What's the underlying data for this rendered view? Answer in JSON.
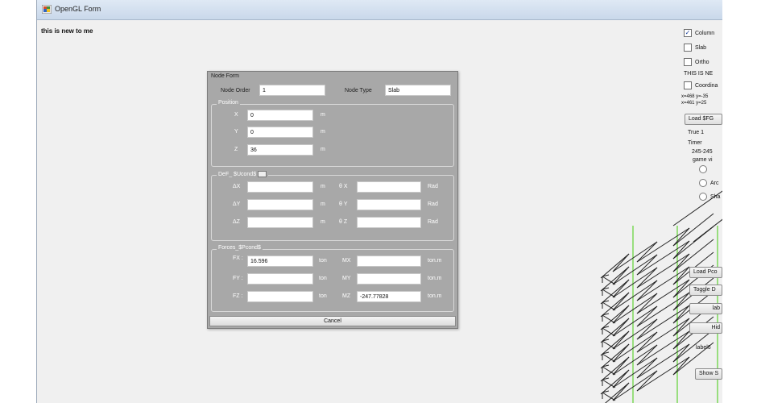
{
  "window": {
    "title": "OpenGL Form",
    "label": "this is new to me"
  },
  "node_form": {
    "title": "Node Form",
    "node_order_label": "Node Order",
    "node_order_value": "1",
    "node_type_label": "Node Type",
    "node_type_value": "Slab",
    "position": {
      "title": "Position",
      "x_label": "X",
      "x_value": "0",
      "y_label": "Y",
      "y_value": "0",
      "z_label": "Z",
      "z_value": "36",
      "unit": "m"
    },
    "deformation": {
      "title": "DeF_ $Ucond$",
      "dx_label": "ΔX",
      "dy_label": "ΔY",
      "dz_label": "ΔZ",
      "unit_m": "m",
      "rx_label": "θ X",
      "ry_label": "θ Y",
      "rz_label": "θ Z",
      "unit_rad": "Rad"
    },
    "forces": {
      "title": "Forces_$Pcond$",
      "fx_label": "FX :",
      "fx_value": "16.596",
      "fy_label": "FY :",
      "fy_value": "",
      "fz_label": "FZ :",
      "fz_value": "",
      "unit_ton": "ton",
      "mx_label": "MX",
      "mx_value": "",
      "my_label": "MY",
      "my_value": "",
      "mz_label": "MZ",
      "mz_value": "-247.77828",
      "unit_tonm": "ton.m"
    },
    "cancel_label": "Cancel"
  },
  "right_panel": {
    "columns_label": "Column",
    "columns_checked": true,
    "slab_label": "Slab",
    "ortho_label": "Ortho",
    "this_is_ne": "THIS IS NE",
    "coordinates_label": "Coordina",
    "coords_line1": "x=468 y=-35",
    "coords_line2": "x=461 y=25",
    "load_btn": "Load $FG",
    "true_line": "True 1",
    "timer_label": "Timer",
    "timer_value": "245-245",
    "game_label": "game vi",
    "radio1": "",
    "radio2": "Arc",
    "radio3": "Sha",
    "load_pcond_btn": "Load Pco",
    "toggle_btn": "Toggle D",
    "lab_btn": "lab",
    "hid_btn": "Hid",
    "label6": "label6",
    "show_btn": "Show S"
  },
  "colors": {
    "dialog_bg": "#a8a8a8",
    "scene_green": "#5fd234",
    "scene_line": "#222222"
  }
}
